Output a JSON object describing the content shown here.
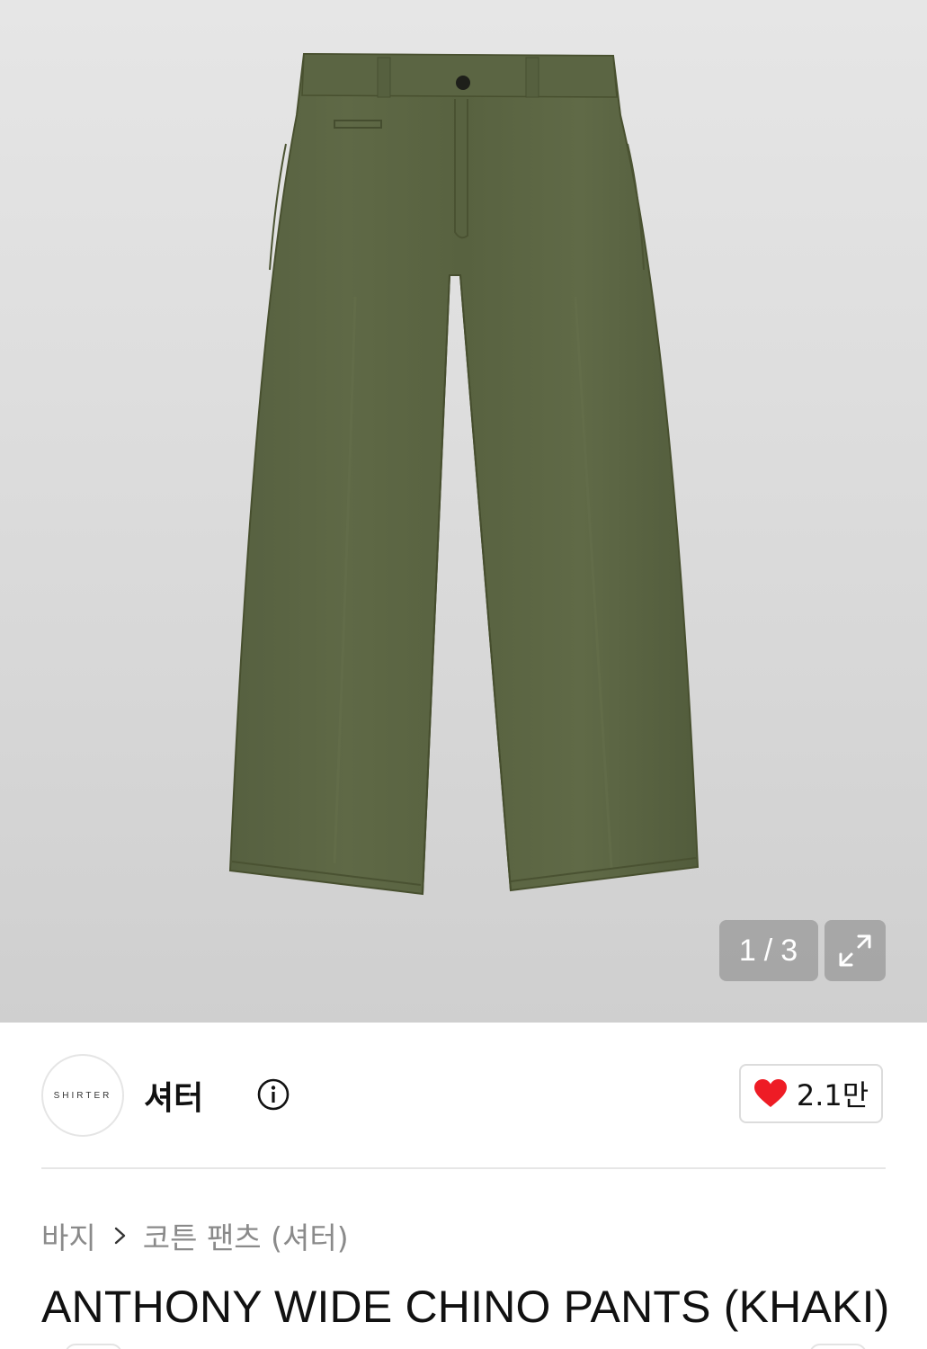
{
  "gallery": {
    "image_alt": "Khaki wide chino pants",
    "current": "1",
    "separator": "/",
    "total": "3",
    "expand_icon": "expand-icon",
    "product_color": "#5c6542"
  },
  "brand": {
    "logo_text": "SHIRTER",
    "name": "셔터",
    "info_icon": "info-icon"
  },
  "like": {
    "icon": "heart-icon",
    "count": "2.1만",
    "heart_color": "#ee1c25"
  },
  "breadcrumb": {
    "category": "바지",
    "subcategory": "코튼 팬츠 (셔터)",
    "chevron_icon": "chevron-right-icon"
  },
  "product": {
    "title": "ANTHONY WIDE CHINO PANTS (KHAKI)"
  }
}
